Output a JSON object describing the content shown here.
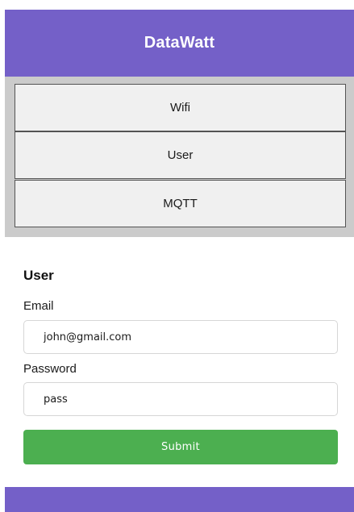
{
  "header": {
    "title": "DataWatt"
  },
  "nav": {
    "items": [
      {
        "label": "Wifi"
      },
      {
        "label": "User"
      },
      {
        "label": "MQTT"
      }
    ]
  },
  "form": {
    "section_title": "User",
    "email": {
      "label": "Email",
      "value": "john@gmail.com"
    },
    "password": {
      "label": "Password",
      "value": "pass"
    },
    "submit_label": "Submit"
  },
  "colors": {
    "brand": "#7460c8",
    "nav_background": "#cbcbcb",
    "nav_item_background": "#f0f0f0",
    "submit": "#4caf50"
  }
}
